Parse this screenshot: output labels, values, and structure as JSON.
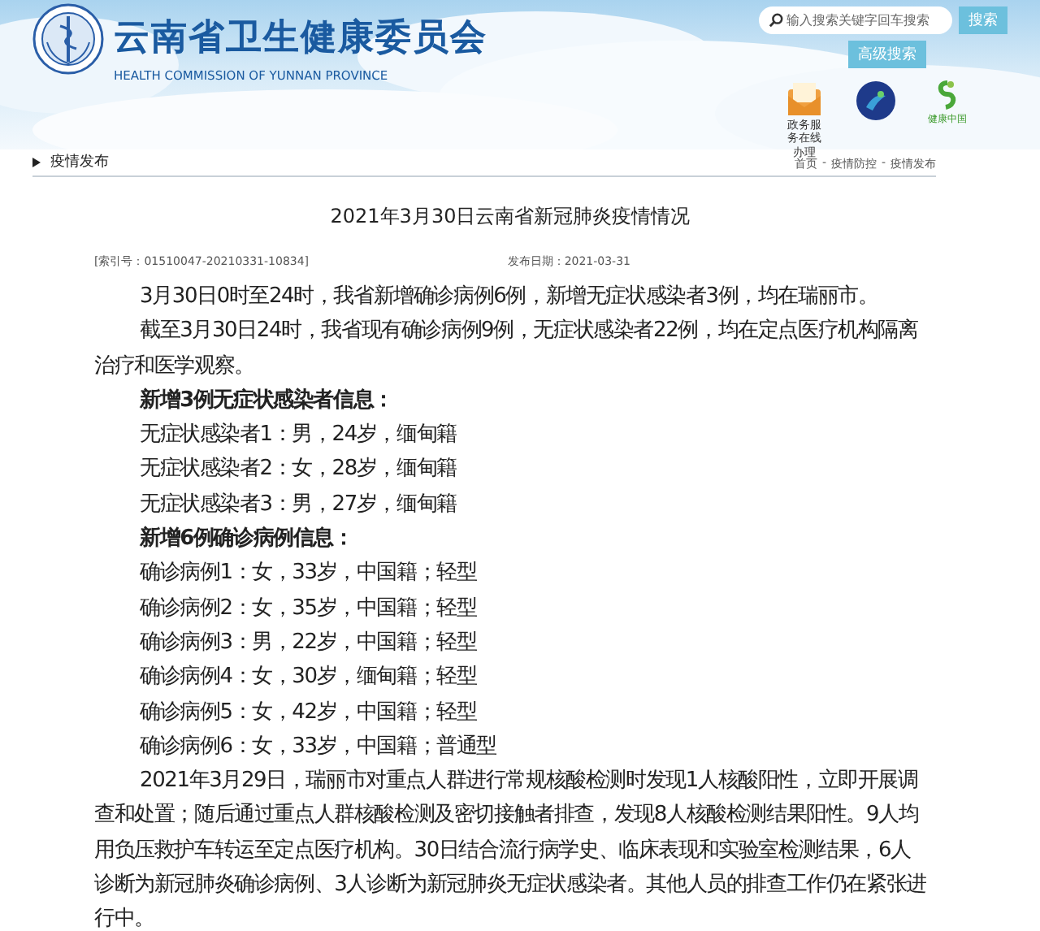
{
  "header": {
    "org_name": "云南省卫生健康委员会",
    "org_name_en": "HEALTH COMMISSION OF YUNNAN PROVINCE",
    "search": {
      "placeholder": "输入搜索关键字回车搜索"
    },
    "search_button": "搜索",
    "advanced_search_button": "高级搜索",
    "shortcuts": [
      {
        "kind": "service",
        "label": "政务服务在线办理"
      },
      {
        "kind": "emblem"
      },
      {
        "kind": "health",
        "label": "健康中国"
      }
    ]
  },
  "nav": {
    "section": "疫情发布",
    "breadcrumb": [
      "首页",
      "疫情防控",
      "疫情发布"
    ],
    "separator": "-"
  },
  "article": {
    "title": "2021年3月30日云南省新冠肺炎疫情情况",
    "index_no": "[索引号：01510047-20210331-10834]",
    "date": "发布日期：2021-03-31",
    "paragraphs": [
      {
        "kind": "text",
        "text": "3月30日0时至24时，我省新增确诊病例6例，新增无症状感染者3例，均在瑞丽市。"
      },
      {
        "kind": "text",
        "text": "截至3月30日24时，我省现有确诊病例9例，无症状感染者22例，均在定点医疗机构隔离治疗和医学观察。"
      },
      {
        "kind": "heading",
        "text": "新增3例无症状感染者信息："
      },
      {
        "kind": "text",
        "text": "无症状感染者1：男，24岁，缅甸籍"
      },
      {
        "kind": "text",
        "text": "无症状感染者2：女，28岁，缅甸籍"
      },
      {
        "kind": "text",
        "text": "无症状感染者3：男，27岁，缅甸籍"
      },
      {
        "kind": "heading",
        "text": "新增6例确诊病例信息："
      },
      {
        "kind": "text",
        "text": "确诊病例1：女，33岁，中国籍；轻型"
      },
      {
        "kind": "text",
        "text": "确诊病例2：女，35岁，中国籍；轻型"
      },
      {
        "kind": "text",
        "text": "确诊病例3：男，22岁，中国籍；轻型"
      },
      {
        "kind": "text",
        "text": "确诊病例4：女，30岁，缅甸籍；轻型"
      },
      {
        "kind": "text",
        "text": "确诊病例5：女，42岁，中国籍；轻型"
      },
      {
        "kind": "text",
        "text": "确诊病例6：女，33岁，中国籍；普通型"
      },
      {
        "kind": "text",
        "text": "2021年3月29日，瑞丽市对重点人群进行常规核酸检测时发现1人核酸阳性，立即开展调查和处置；随后通过重点人群核酸检测及密切接触者排查，发现8人核酸检测结果阳性。9人均用负压救护车转运至定点医疗机构。30日结合流行病学史、临床表现和实验室检测结果，6人诊断为新冠肺炎确诊病例、3人诊断为新冠肺炎无症状感染者。其他人员的排查工作仍在紧张进行中。"
      }
    ]
  }
}
